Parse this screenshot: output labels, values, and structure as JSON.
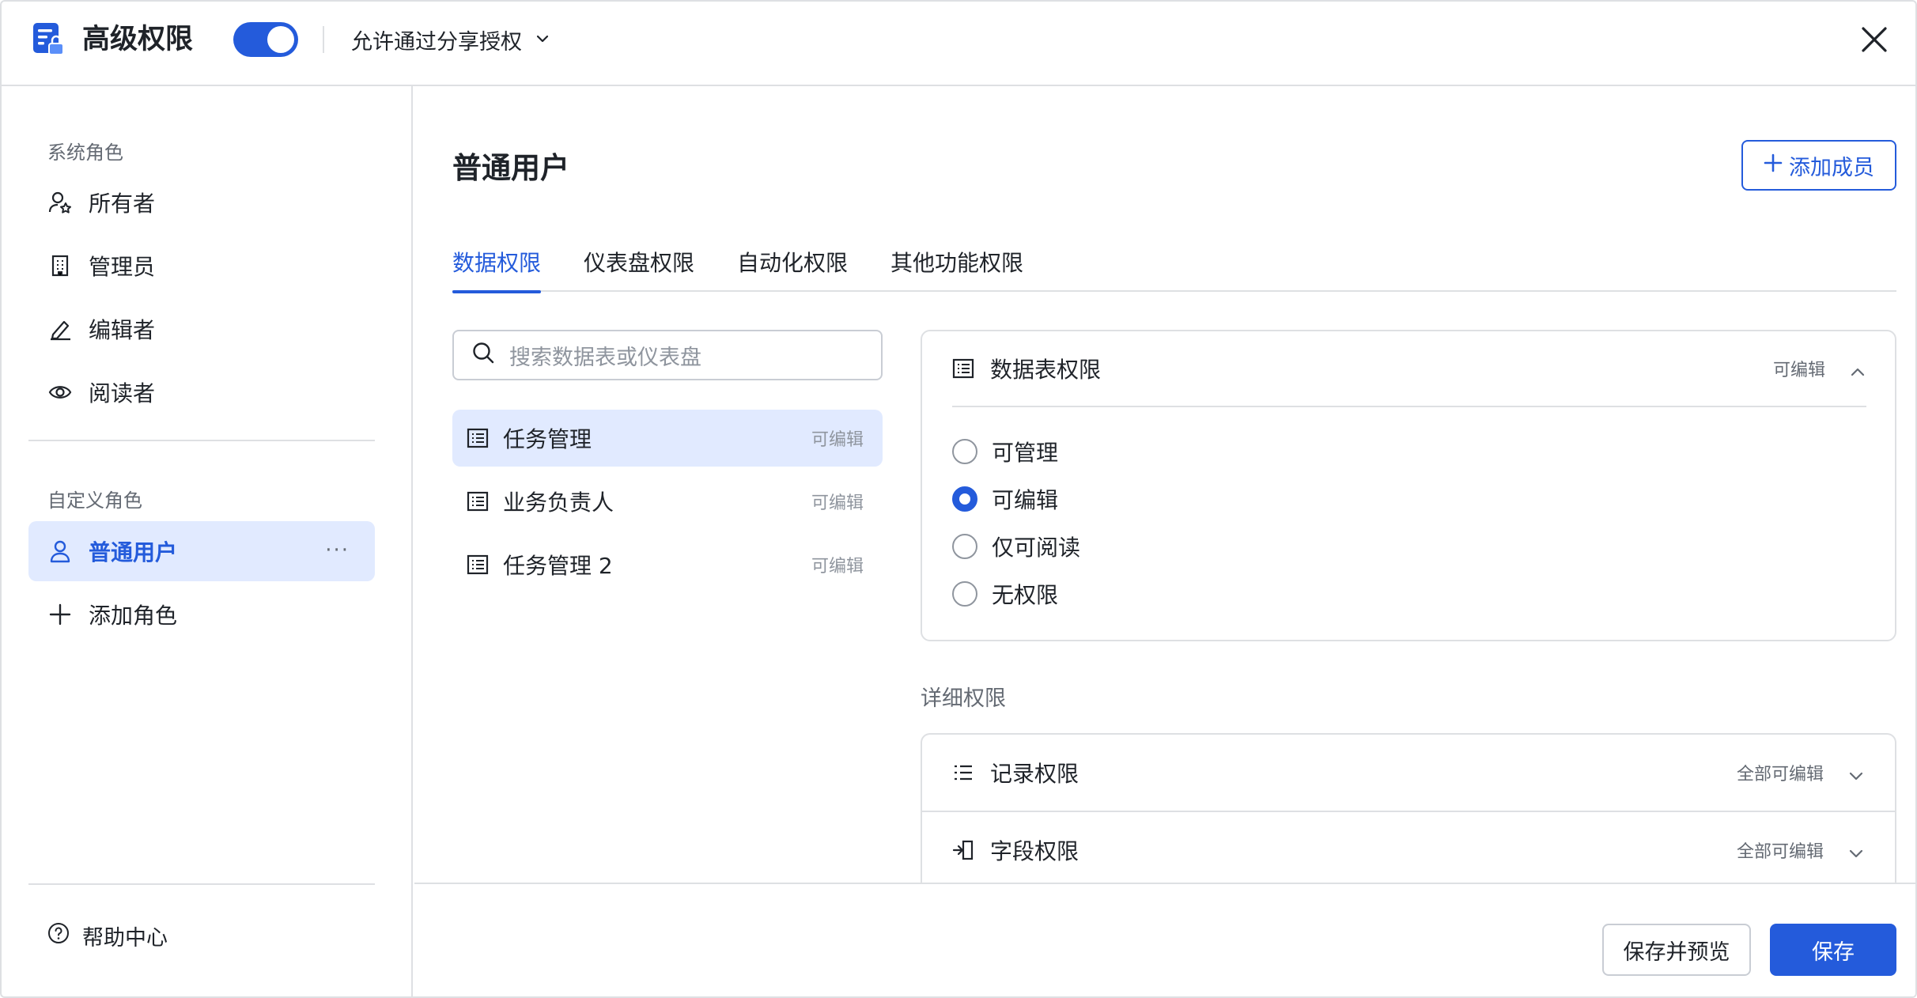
{
  "header": {
    "title": "高级权限",
    "toggle_on": true,
    "share_label": "允许通过分享授权"
  },
  "sidebar": {
    "system_roles_label": "系统角色",
    "system_roles": [
      {
        "label": "所有者",
        "icon": "user-star-icon"
      },
      {
        "label": "管理员",
        "icon": "building-icon"
      },
      {
        "label": "编辑者",
        "icon": "pencil-icon"
      },
      {
        "label": "阅读者",
        "icon": "eye-icon"
      }
    ],
    "custom_roles_label": "自定义角色",
    "custom_roles": [
      {
        "label": "普通用户",
        "icon": "user-icon",
        "active": true,
        "more": "···"
      }
    ],
    "add_role_label": "添加角色",
    "help_label": "帮助中心"
  },
  "main": {
    "title": "普通用户",
    "add_member_label": "添加成员",
    "tabs": [
      {
        "label": "数据权限",
        "active": true
      },
      {
        "label": "仪表盘权限"
      },
      {
        "label": "自动化权限"
      },
      {
        "label": "其他功能权限"
      }
    ],
    "search_placeholder": "搜索数据表或仪表盘",
    "tables": [
      {
        "name": "任务管理",
        "perm": "可编辑",
        "selected": true
      },
      {
        "name": "业务负责人",
        "perm": "可编辑"
      },
      {
        "name": "任务管理 2",
        "perm": "可编辑"
      }
    ],
    "table_permission": {
      "title": "数据表权限",
      "value": "可编辑",
      "options": [
        {
          "label": "可管理",
          "checked": false
        },
        {
          "label": "可编辑",
          "checked": true
        },
        {
          "label": "仅可阅读",
          "checked": false
        },
        {
          "label": "无权限",
          "checked": false
        }
      ]
    },
    "detail_label": "详细权限",
    "details": [
      {
        "label": "记录权限",
        "value": "全部可编辑",
        "icon": "list-icon"
      },
      {
        "label": "字段权限",
        "value": "全部可编辑",
        "icon": "field-icon"
      }
    ]
  },
  "footer": {
    "preview_label": "保存并预览",
    "save_label": "保存"
  },
  "colors": {
    "accent": "#245bdb",
    "selected_bg": "#e1eaff",
    "border": "#dee0e3",
    "muted_text": "#646a73"
  }
}
